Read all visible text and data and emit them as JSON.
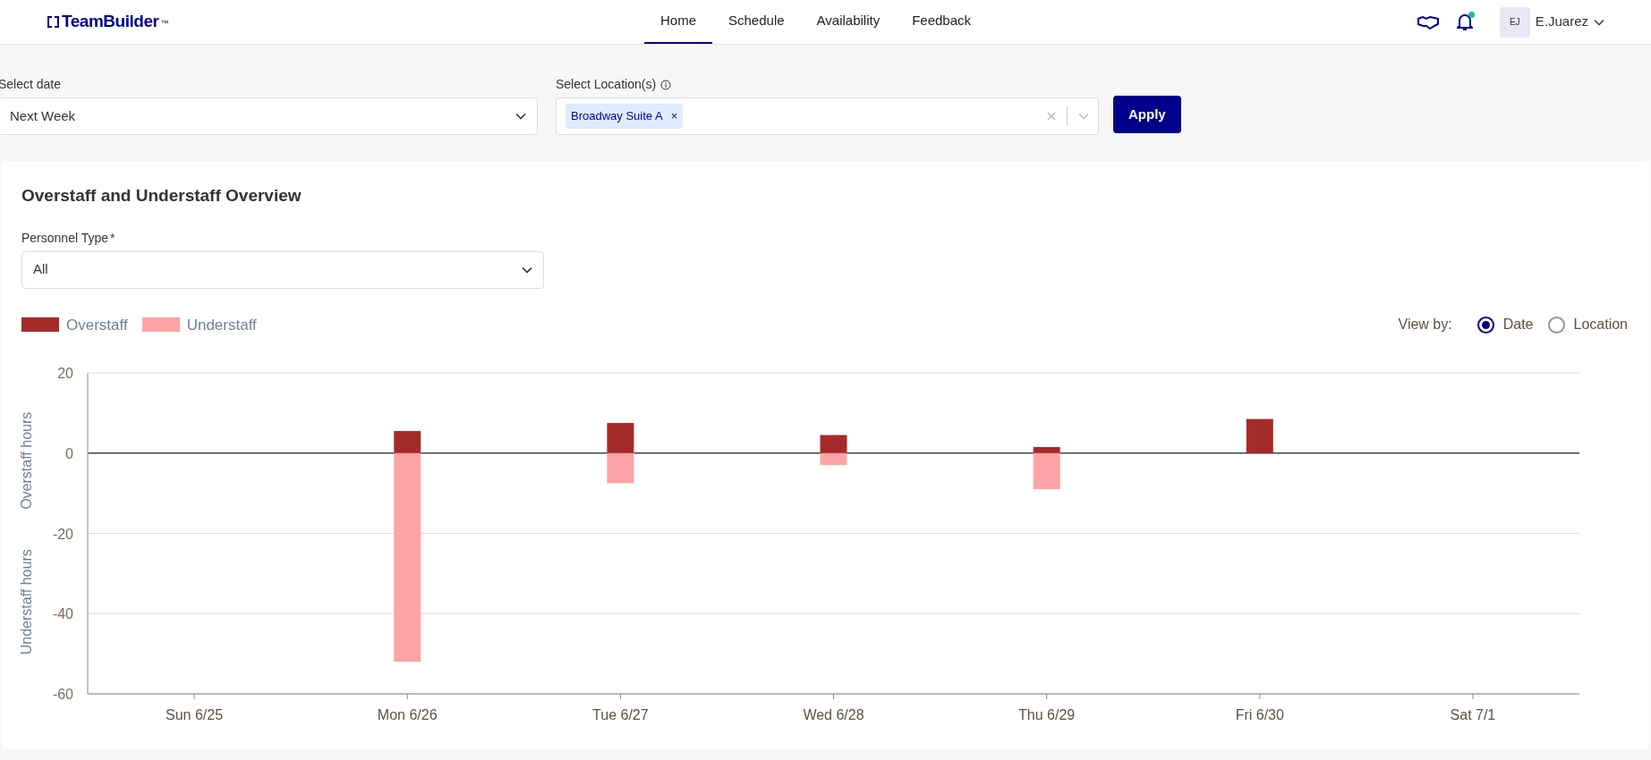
{
  "header": {
    "logo": "TeamBuilder",
    "logo_mark": "™",
    "nav": [
      {
        "label": "Home",
        "selected": true
      },
      {
        "label": "Schedule",
        "selected": false
      },
      {
        "label": "Availability",
        "selected": false
      },
      {
        "label": "Feedback",
        "selected": false
      }
    ],
    "notification_dot": true,
    "user": {
      "initials": "EJ",
      "name": "E.Juarez"
    }
  },
  "filters": {
    "date": {
      "label": "Select date",
      "value": "Next Week"
    },
    "locations": {
      "label": "Select Location(s)",
      "tags": [
        "Broadway Suite A"
      ],
      "tag_remove": "×"
    },
    "apply": "Apply"
  },
  "overview": {
    "title": "Overstaff and Understaff Overview",
    "personnel": {
      "label": "Personnel Type",
      "required": "*",
      "value": "All"
    },
    "view_by": {
      "label": "View by:",
      "options": [
        {
          "label": "Date",
          "selected": true
        },
        {
          "label": "Location",
          "selected": false
        }
      ]
    },
    "chart_data": {
      "type": "bar",
      "stacked": true,
      "categories": [
        "Sun 6/25",
        "Mon 6/26",
        "Tue 6/27",
        "Wed 6/28",
        "Thu 6/29",
        "Fri 6/30",
        "Sat 7/1"
      ],
      "ylim": [
        -60,
        20
      ],
      "yticks": [
        20,
        0,
        -20,
        -40,
        -60
      ],
      "ylabel": "Understaff hours          Overstaff hours",
      "series": [
        {
          "name": "Overstaff",
          "color": "#a52a2a",
          "values": [
            null,
            5.5,
            7.5,
            4.5,
            1.5,
            8.5,
            null
          ]
        },
        {
          "name": "Understaff",
          "color": "#ffa3a6",
          "values": [
            null,
            -52,
            -7.5,
            -3,
            -9,
            null,
            null
          ]
        }
      ]
    }
  }
}
